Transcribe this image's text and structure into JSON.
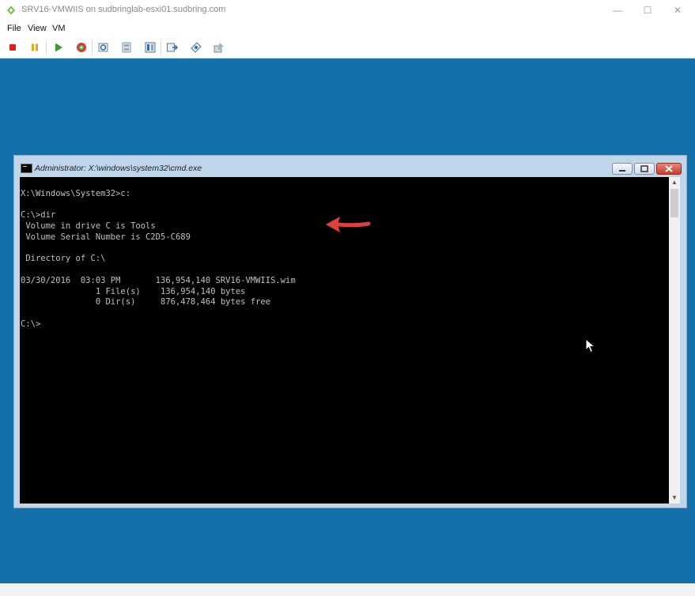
{
  "window": {
    "title": "SRV16-VMWIIS on sudbringlab-esxi01.sudbring.com",
    "controls": [
      "—",
      "☐",
      "✕"
    ]
  },
  "menu": [
    "File",
    "View",
    "VM"
  ],
  "toolbar": {
    "buttons": [
      "stop-icon",
      "pause-icon",
      "play-icon",
      "reset-icon",
      "snapshot-icon",
      "revert-snapshot-icon",
      "manage-snapshots-icon",
      "send-ctrl-alt-del-icon",
      "settings-icon",
      "install-tools-icon"
    ]
  },
  "cmd": {
    "title": "Administrator: X:\\windows\\system32\\cmd.exe",
    "lines": [
      "X:\\Windows\\System32>c:",
      "",
      "C:\\>dir",
      " Volume in drive C is Tools",
      " Volume Serial Number is C2D5-C689",
      "",
      " Directory of C:\\",
      "",
      "03/30/2016  03:03 PM       136,954,140 SRV16-VMWIIS.wim",
      "               1 File(s)    136,954,140 bytes",
      "               0 Dir(s)     876,478,464 bytes free",
      "",
      "C:\\>"
    ]
  },
  "colors": {
    "console_bg": "#1370a8",
    "terminal_bg": "#000000",
    "terminal_fg": "#c0c0c0",
    "annotation_arrow": "#e0403a"
  }
}
